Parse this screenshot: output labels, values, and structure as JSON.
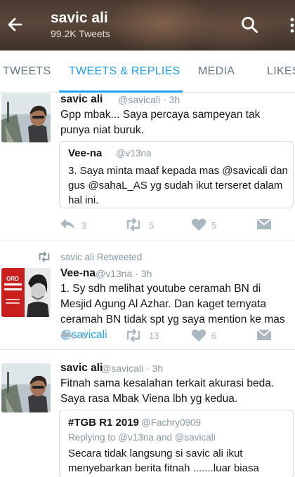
{
  "header": {
    "title": "savic ali",
    "subtitle": "99.2K Tweets"
  },
  "tabs": [
    {
      "label": "TWEETS"
    },
    {
      "label": "TWEETS & REPLIES"
    },
    {
      "label": "MEDIA"
    },
    {
      "label": "LIKES"
    }
  ],
  "tweets": [
    {
      "name": "savic ali",
      "handle": "@savicali · 3h",
      "text": "Gpp mbak... Saya percaya sampeyan tak punya niat buruk.",
      "quote": {
        "name": "Vee-na",
        "handle": "@v13na",
        "text": "3. Saya minta maaf kepada mas @savicali  dan gus @sahaL_AS  yg sudah ikut terseret dalam hal ini."
      },
      "replies": "3",
      "retweets": "5",
      "likes": "5"
    },
    {
      "retweeted_by": "savic ali Retweeted",
      "name": "Vee-na",
      "handle": "@v13na · 3h",
      "text": "1. Sy sdh melihat youtube ceramah BN di Mesjid Agung Al Azhar. Dan  kaget ternyata ceramah BN tidak spt yg saya mention ke mas ",
      "text_mention": "@savicali",
      "replies": "8",
      "retweets": "13",
      "likes": "6"
    },
    {
      "name": "savic ali",
      "handle": "@savicali · 3h",
      "text": "Fitnah sama kesalahan terkait akurasi beda. Saya rasa Mbak Viena lbh yg kedua.",
      "quote": {
        "name": "#TGB R1 2019",
        "handle": "@Fachry0909",
        "reply_to": "Replying to @v13na and @savicali",
        "text": "Secara tidak langsung si savic ali ikut menyebarkan berita fitnah .......luar biasa"
      }
    }
  ],
  "colors": {
    "accent": "#1da1f2",
    "muted": "#8899a6",
    "icon": "#aab8c2"
  }
}
